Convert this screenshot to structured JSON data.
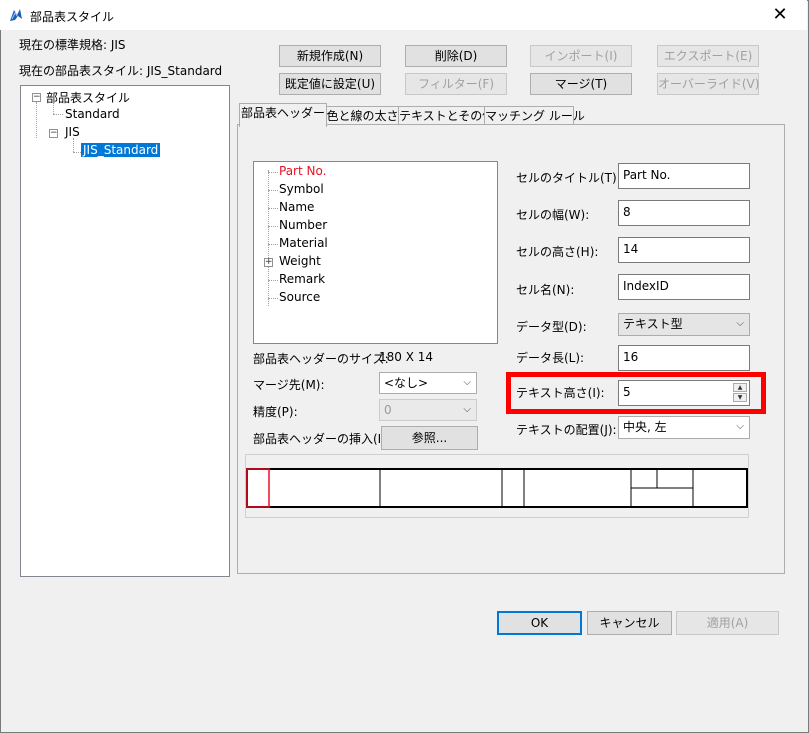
{
  "window": {
    "title": "部品表スタイル"
  },
  "info": {
    "standard_label": "現在の標準規格: JIS",
    "style_label": "現在の部品表スタイル: JIS_Standard"
  },
  "buttons": {
    "new": "新規作成(N)",
    "delete": "削除(D)",
    "import": "インポート(I)",
    "export": "エクスポート(E)",
    "set_default": "既定値に設定(U)",
    "filter": "フィルター(F)",
    "merge": "マージ(T)",
    "override": "オーバーライド(V)",
    "browse": "参照...",
    "ok": "OK",
    "cancel": "キャンセル",
    "apply": "適用(A)"
  },
  "style_tree": {
    "root": "部品表スタイル",
    "items": [
      "Standard",
      "JIS",
      "JIS_Standard"
    ]
  },
  "tabs": [
    "部品表ヘッダー",
    "色と線の太さ",
    "テキストとその他",
    "マッチング ルール"
  ],
  "header_tree": {
    "items": [
      "Part No.",
      "Symbol",
      "Name",
      "Number",
      "Material",
      "Weight",
      "Remark",
      "Source"
    ]
  },
  "left_fields": {
    "size_label": "部品表ヘッダーのサイズ:",
    "size_value": "180 X 14",
    "merge_to_label": "マージ先(M):",
    "merge_to_value": "<なし>",
    "precision_label": "精度(P):",
    "precision_value": "0",
    "insert_label": "部品表ヘッダーの挿入(I):"
  },
  "right_fields": {
    "cell_title_label": "セルのタイトル(T):",
    "cell_title_value": "Part No.",
    "cell_width_label": "セルの幅(W):",
    "cell_width_value": "8",
    "cell_height_label": "セルの高さ(H):",
    "cell_height_value": "14",
    "cell_name_label": "セル名(N):",
    "cell_name_value": "IndexID",
    "data_type_label": "データ型(D):",
    "data_type_value": "テキスト型",
    "data_length_label": "データ長(L):",
    "data_length_value": "16",
    "text_height_label": "テキスト高さ(I):",
    "text_height_value": "5",
    "text_align_label": "テキストの配置(J):",
    "text_align_value": "中央, 左"
  },
  "colors": {
    "accent": "#0078d7",
    "highlight": "#ff0000",
    "selected_item": "#e81123"
  }
}
